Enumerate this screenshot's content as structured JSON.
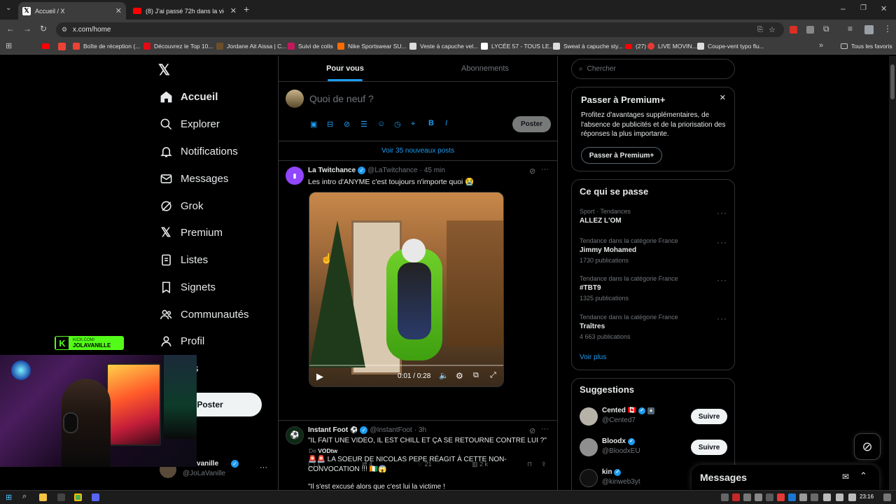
{
  "browser": {
    "tabs": [
      {
        "label": "Accueil / X",
        "active": true
      },
      {
        "label": "(8) J'ai passé 72h dans la vie de",
        "active": false
      }
    ],
    "url": "x.com/home",
    "bookmarks": [
      "Boîte de réception (...",
      "Découvrez le Top 10...",
      "Jordane Ait Aissa | C...",
      "Suivi de colis",
      "Nike Sportswear SU...",
      "Veste à capuche vel...",
      "LYCÉE 57 - TOUS LE...",
      "Sweat à capuche sty...",
      "(27)",
      "LIVE MOVIN...",
      "Coupe-vent typo flu..."
    ],
    "all_bookmarks": "Tous les favoris"
  },
  "sidebar": {
    "items": [
      {
        "label": "Accueil",
        "icon": "home-icon"
      },
      {
        "label": "Explorer",
        "icon": "search-icon"
      },
      {
        "label": "Notifications",
        "icon": "bell-icon"
      },
      {
        "label": "Messages",
        "icon": "mail-icon"
      },
      {
        "label": "Grok",
        "icon": "grok-icon"
      },
      {
        "label": "Premium",
        "icon": "x-icon"
      },
      {
        "label": "Listes",
        "icon": "list-icon"
      },
      {
        "label": "Signets",
        "icon": "bookmark-icon"
      },
      {
        "label": "Communautés",
        "icon": "people-icon"
      },
      {
        "label": "Profil",
        "icon": "person-icon"
      }
    ],
    "post_button": "Poster",
    "account_name": "Jolavanille",
    "account_handle": "@JoLaVanille"
  },
  "overlay": {
    "kick_label": "KICK.COM/",
    "kick_name": "JOLAVANILLE"
  },
  "feed": {
    "tabs": [
      "Pour vous",
      "Abonnements"
    ],
    "compose_placeholder": "Quoi de neuf ?",
    "post_button": "Poster",
    "new_posts": "Voir 35 nouveaux posts",
    "posts": [
      {
        "author": "La Twitchance",
        "handle": "@LaTwitchance",
        "time": "45 min",
        "text": "Les intro d'ANYME c'est toujours n'importe quoi 😭",
        "video_time": "0:01 / 0:28",
        "source_prefix": "De",
        "source": "VODtw",
        "replies": "1",
        "reposts": "4",
        "likes": "21",
        "views": "2 k"
      },
      {
        "author": "Instant Foot",
        "handle": "@InstantFoot",
        "time": "3h",
        "line1": "\"IL FAIT UNE VIDEO, IL EST CHILL ET ÇA SE RETOURNE CONTRE LUI ?\"",
        "line2": "🚨🚨 LA SOEUR DE NICOLAS PEPE RÉAGIT À CETTE NON-CONVOCATION !!! 🇨🇮😱",
        "line3": "\"Il s'est excusé alors que c'est lui la victime !"
      }
    ]
  },
  "right": {
    "search_placeholder": "Chercher",
    "premium": {
      "title": "Passer à Premium+",
      "body": "Profitez d'avantages supplémentaires, de l'absence de publicités et de la priorisation des réponses la plus importante.",
      "button": "Passer à Premium+"
    },
    "trends": {
      "title": "Ce qui se passe",
      "items": [
        {
          "context": "Sport · Tendances",
          "name": "ALLEZ L'OM",
          "count": ""
        },
        {
          "context": "Tendance dans la catégorie France",
          "name": "Jimmy Mohamed",
          "count": "1730 publications"
        },
        {
          "context": "Tendance dans la catégorie France",
          "name": "#TBT9",
          "count": "1325 publications"
        },
        {
          "context": "Tendance dans la catégorie France",
          "name": "Traîtres",
          "count": "4 663 publications"
        }
      ],
      "more": "Voir plus"
    },
    "suggestions": {
      "title": "Suggestions",
      "items": [
        {
          "name": "Cented 🇨🇦",
          "handle": "@Cented7",
          "button": "Suivre"
        },
        {
          "name": "Bloodx",
          "handle": "@BloodxEU",
          "button": "Suivre"
        },
        {
          "name": "kin",
          "handle": "@kinweb3yt",
          "button": ""
        }
      ]
    },
    "messages": "Messages"
  },
  "taskbar": {
    "time": "23:16"
  }
}
